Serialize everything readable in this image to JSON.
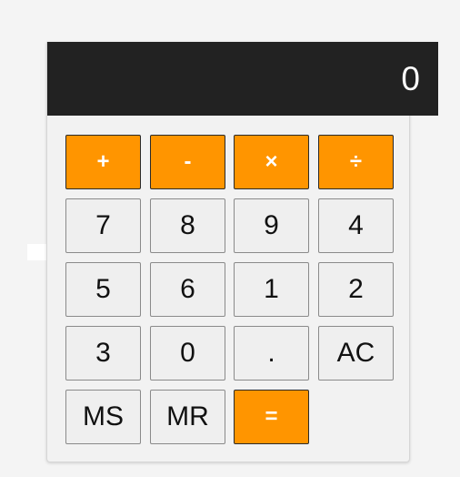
{
  "display": {
    "value": "0"
  },
  "buttons": {
    "add": "+",
    "subtract": "-",
    "multiply": "×",
    "divide": "÷",
    "seven": "7",
    "eight": "8",
    "nine": "9",
    "four": "4",
    "five": "5",
    "six": "6",
    "one": "1",
    "two": "2",
    "three": "3",
    "zero": "0",
    "decimal": ".",
    "all_clear": "AC",
    "memory_store": "MS",
    "memory_recall": "MR",
    "equals": "="
  },
  "colors": {
    "operator": "#ff9500",
    "display_bg": "#222222",
    "key_bg": "#efefef"
  }
}
